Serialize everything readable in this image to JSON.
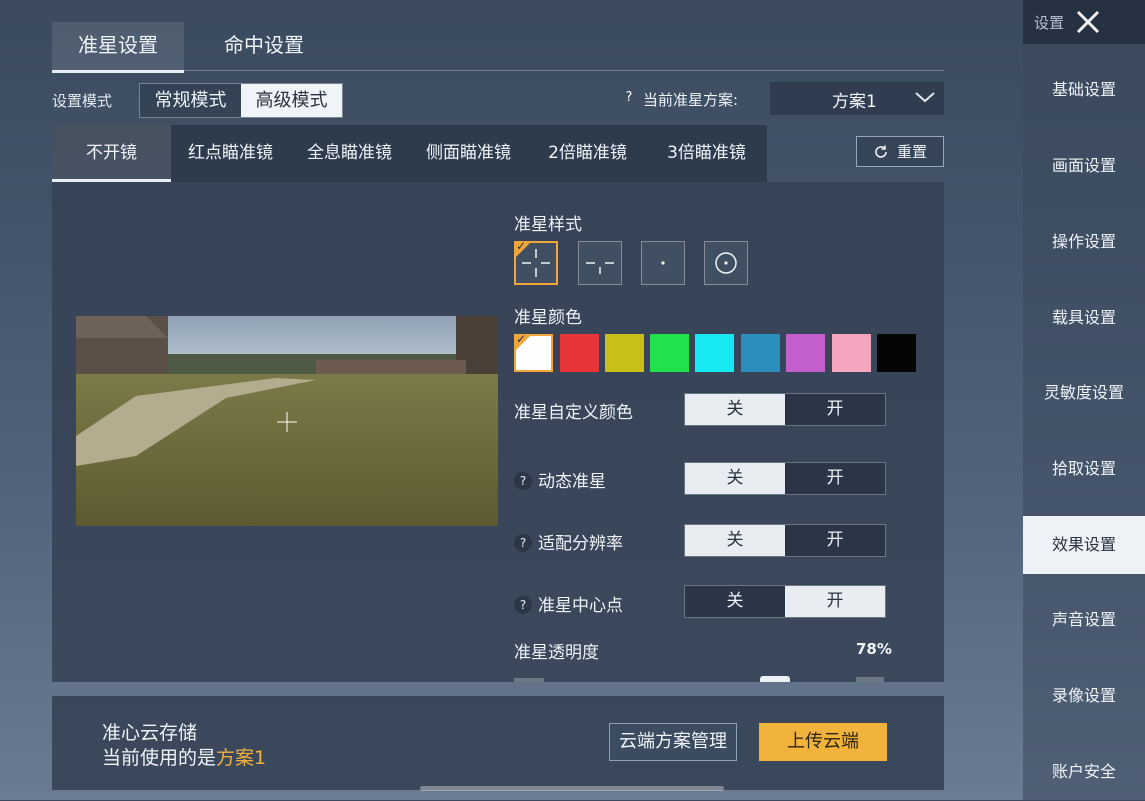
{
  "tabs": {
    "crosshair": "准星设置",
    "hit": "命中设置"
  },
  "mode": {
    "label": "设置模式",
    "options": [
      "常规模式",
      "高级模式"
    ],
    "selected": "高级模式"
  },
  "scheme": {
    "label": "当前准星方案:",
    "value": "方案1",
    "help": "?"
  },
  "scope_tabs": [
    "不开镜",
    "红点瞄准镜",
    "全息瞄准镜",
    "侧面瞄准镜",
    "2倍瞄准镜",
    "3倍瞄准镜"
  ],
  "reset_label": "重置",
  "style": {
    "title": "准星样式",
    "icons": [
      "crosshair-cross-icon",
      "crosshair-split-icon",
      "crosshair-dot-icon",
      "crosshair-circle-icon"
    ],
    "selected_index": 0
  },
  "color": {
    "title": "准星颜色",
    "swatches": [
      "#ffffff",
      "#e8353a",
      "#c9bf1b",
      "#21e24a",
      "#17e9f2",
      "#2a8fbd",
      "#c45fce",
      "#f6a5bf",
      "#050505"
    ],
    "selected_index": 0
  },
  "rows": {
    "custom_color": {
      "label": "准星自定义颜色",
      "off": "关",
      "on": "开",
      "value": "关"
    },
    "dynamic": {
      "label": "动态准星",
      "off": "关",
      "on": "开",
      "value": "关"
    },
    "resolution": {
      "label": "适配分辨率",
      "off": "关",
      "on": "开",
      "value": "关"
    },
    "center_dot": {
      "label": "准星中心点",
      "off": "关",
      "on": "开",
      "value": "开"
    }
  },
  "opacity": {
    "label": "准星透明度",
    "value": "78%"
  },
  "cloud": {
    "title": "准心云存储",
    "sub_prefix": "当前使用的是",
    "sub_scheme": "方案1",
    "manage_label": "云端方案管理",
    "upload_label": "上传云端"
  },
  "sidebar": {
    "header": "设置",
    "items": [
      "基础设置",
      "画面设置",
      "操作设置",
      "载具设置",
      "灵敏度设置",
      "拾取设置",
      "效果设置",
      "声音设置",
      "录像设置",
      "账户安全"
    ],
    "active": "效果设置"
  }
}
